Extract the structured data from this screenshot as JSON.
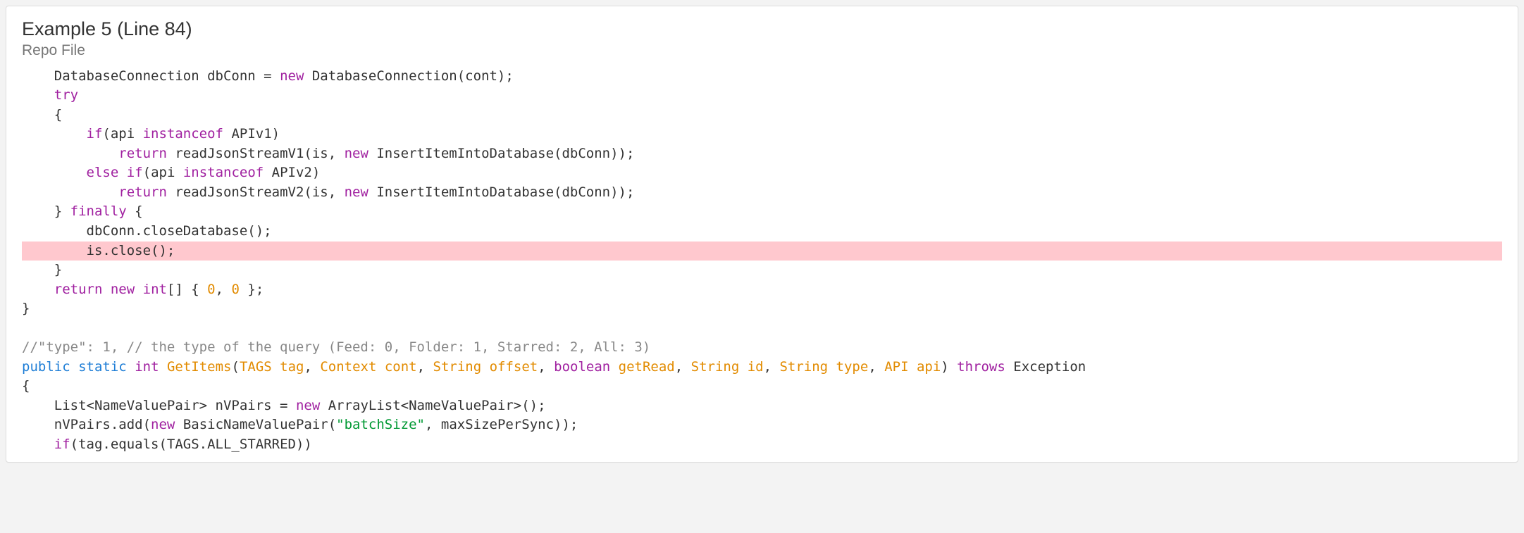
{
  "header": {
    "title": "Example 5 (Line 84)",
    "subtitle": "Repo File"
  },
  "code": {
    "lines": [
      {
        "indent": 1,
        "hl": false,
        "tokens": [
          {
            "t": "DatabaseConnection dbConn = "
          },
          {
            "t": "new",
            "c": "kw"
          },
          {
            "t": " DatabaseConnection(cont);"
          }
        ]
      },
      {
        "indent": 1,
        "hl": false,
        "tokens": [
          {
            "t": "try",
            "c": "kw"
          }
        ]
      },
      {
        "indent": 1,
        "hl": false,
        "tokens": [
          {
            "t": "{"
          }
        ]
      },
      {
        "indent": 2,
        "hl": false,
        "tokens": [
          {
            "t": "if",
            "c": "kw"
          },
          {
            "t": "(api "
          },
          {
            "t": "instanceof",
            "c": "kw"
          },
          {
            "t": " APIv1)"
          }
        ]
      },
      {
        "indent": 3,
        "hl": false,
        "tokens": [
          {
            "t": "return",
            "c": "kw"
          },
          {
            "t": " readJsonStreamV1(is, "
          },
          {
            "t": "new",
            "c": "kw"
          },
          {
            "t": " InsertItemIntoDatabase(dbConn));"
          }
        ]
      },
      {
        "indent": 2,
        "hl": false,
        "tokens": [
          {
            "t": "else",
            "c": "kw"
          },
          {
            "t": " "
          },
          {
            "t": "if",
            "c": "kw"
          },
          {
            "t": "(api "
          },
          {
            "t": "instanceof",
            "c": "kw"
          },
          {
            "t": " APIv2)"
          }
        ]
      },
      {
        "indent": 3,
        "hl": false,
        "tokens": [
          {
            "t": "return",
            "c": "kw"
          },
          {
            "t": " readJsonStreamV2(is, "
          },
          {
            "t": "new",
            "c": "kw"
          },
          {
            "t": " InsertItemIntoDatabase(dbConn));"
          }
        ]
      },
      {
        "indent": 1,
        "hl": false,
        "tokens": [
          {
            "t": "} "
          },
          {
            "t": "finally",
            "c": "kw"
          },
          {
            "t": " {"
          }
        ]
      },
      {
        "indent": 2,
        "hl": false,
        "tokens": [
          {
            "t": "dbConn.closeDatabase();"
          }
        ]
      },
      {
        "indent": 2,
        "hl": true,
        "tokens": [
          {
            "t": "is.close();"
          }
        ]
      },
      {
        "indent": 1,
        "hl": false,
        "tokens": [
          {
            "t": "}"
          }
        ]
      },
      {
        "indent": 1,
        "hl": false,
        "tokens": [
          {
            "t": "return",
            "c": "kw"
          },
          {
            "t": " "
          },
          {
            "t": "new",
            "c": "kw"
          },
          {
            "t": " "
          },
          {
            "t": "int",
            "c": "kw"
          },
          {
            "t": "[] { "
          },
          {
            "t": "0",
            "c": "num"
          },
          {
            "t": ", "
          },
          {
            "t": "0",
            "c": "num"
          },
          {
            "t": " };"
          }
        ]
      },
      {
        "indent": 0,
        "hl": false,
        "tokens": [
          {
            "t": "}"
          }
        ]
      },
      {
        "indent": 0,
        "hl": false,
        "tokens": [
          {
            "t": ""
          }
        ]
      },
      {
        "indent": 0,
        "hl": false,
        "tokens": [
          {
            "t": "//\"type\": 1, // the type of the query (Feed: 0, Folder: 1, Starred: 2, All: 3)",
            "c": "comment"
          }
        ]
      },
      {
        "indent": 0,
        "hl": false,
        "tokens": [
          {
            "t": "public",
            "c": "kwblue"
          },
          {
            "t": " "
          },
          {
            "t": "static",
            "c": "kwblue"
          },
          {
            "t": " "
          },
          {
            "t": "int",
            "c": "kw"
          },
          {
            "t": " "
          },
          {
            "t": "GetItems",
            "c": "name"
          },
          {
            "t": "("
          },
          {
            "t": "TAGS tag",
            "c": "name"
          },
          {
            "t": ", "
          },
          {
            "t": "Context cont",
            "c": "name"
          },
          {
            "t": ", "
          },
          {
            "t": "String offset",
            "c": "name"
          },
          {
            "t": ", "
          },
          {
            "t": "boolean",
            "c": "kw"
          },
          {
            "t": " "
          },
          {
            "t": "getRead",
            "c": "name"
          },
          {
            "t": ", "
          },
          {
            "t": "String id",
            "c": "name"
          },
          {
            "t": ", "
          },
          {
            "t": "String type",
            "c": "name"
          },
          {
            "t": ", "
          },
          {
            "t": "API api",
            "c": "name"
          },
          {
            "t": ") "
          },
          {
            "t": "throws",
            "c": "kw"
          },
          {
            "t": " Exception"
          }
        ]
      },
      {
        "indent": 0,
        "hl": false,
        "tokens": [
          {
            "t": "{"
          }
        ]
      },
      {
        "indent": 1,
        "hl": false,
        "tokens": [
          {
            "t": "List<NameValuePair> nVPairs = "
          },
          {
            "t": "new",
            "c": "kw"
          },
          {
            "t": " ArrayList<NameValuePair>();"
          }
        ]
      },
      {
        "indent": 1,
        "hl": false,
        "tokens": [
          {
            "t": "nVPairs.add("
          },
          {
            "t": "new",
            "c": "kw"
          },
          {
            "t": " BasicNameValuePair("
          },
          {
            "t": "\"batchSize\"",
            "c": "str"
          },
          {
            "t": ", maxSizePerSync));"
          }
        ]
      },
      {
        "indent": 1,
        "hl": false,
        "tokens": [
          {
            "t": "if",
            "c": "kw"
          },
          {
            "t": "(tag.equals(TAGS.ALL_STARRED))"
          }
        ]
      }
    ],
    "indentUnit": "    "
  }
}
